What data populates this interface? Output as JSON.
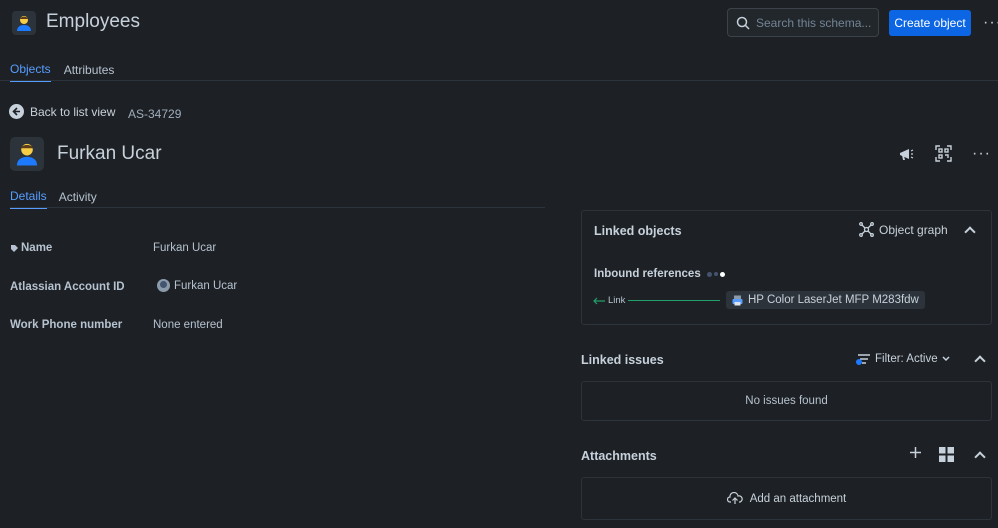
{
  "header": {
    "title": "Employees",
    "search_placeholder": "Search this schema...",
    "create_label": "Create object",
    "more": "···"
  },
  "tabs": [
    {
      "label": "Objects",
      "active": true
    },
    {
      "label": "Attributes",
      "active": false
    }
  ],
  "nav": {
    "back_label": "Back to list view",
    "object_key": "AS-34729"
  },
  "object": {
    "name": "Furkan Ucar"
  },
  "detail_tabs": [
    {
      "label": "Details",
      "active": true
    },
    {
      "label": "Activity",
      "active": false
    }
  ],
  "attributes": [
    {
      "label": "Name",
      "value": "Furkan Ucar"
    },
    {
      "label": "Atlassian Account ID",
      "value": "Furkan Ucar"
    },
    {
      "label": "Work Phone number",
      "value": "None entered"
    }
  ],
  "linked_objects": {
    "title": "Linked objects",
    "graph_label": "Object graph",
    "inbound_label": "Inbound references",
    "link_label": "Link",
    "linked_item": "HP Color LaserJet MFP M283fdw"
  },
  "linked_issues": {
    "title": "Linked issues",
    "filter_label": "Filter: Active",
    "empty_text": "No issues found"
  },
  "attachments": {
    "title": "Attachments",
    "add_label": "Add an attachment"
  },
  "colors": {
    "accent": "#579dff",
    "primary_button": "#0c66e4",
    "background": "#1d2125",
    "link_line": "#22a06b"
  }
}
